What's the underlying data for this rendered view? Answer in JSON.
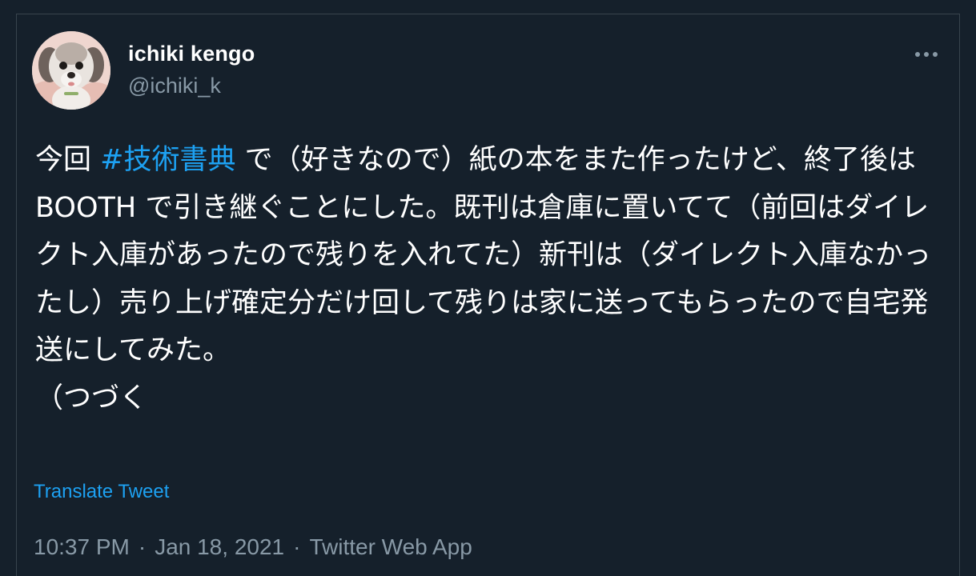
{
  "author": {
    "display_name": "ichiki kengo",
    "handle": "@ichiki_k",
    "avatar_icon": "dog-avatar-photo"
  },
  "menu": {
    "icon": "more-horizontal-icon",
    "glyph": "•••"
  },
  "tweet": {
    "text_before": "今回 ",
    "hashtag": "#技術書典",
    "text_after": " で（好きなので）紙の本をまた作ったけど、終了後は BOOTH で引き継ぐことにした。既刊は倉庫に置いてて（前回はダイレクト入庫があったので残りを入れてた）新刊は（ダイレクト入庫なかったし）売り上げ確定分だけ回して残りは家に送ってもらったので自宅発送にしてみた。\n（つづく"
  },
  "translate_label": "Translate Tweet",
  "meta": {
    "time": "10:37 PM",
    "separator": "·",
    "date": "Jan 18, 2021",
    "source": "Twitter Web App"
  },
  "colors": {
    "background": "#15202b",
    "text": "#ffffff",
    "secondary": "#8899a6",
    "accent": "#1da1f2",
    "border": "#38444d"
  }
}
